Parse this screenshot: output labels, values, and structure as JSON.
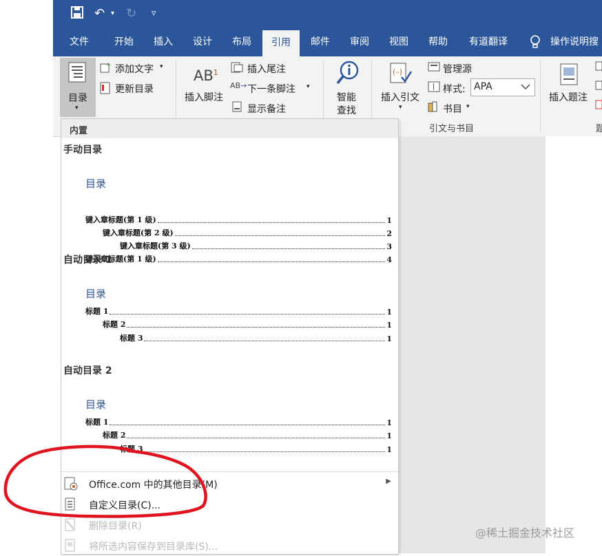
{
  "quick_access": {
    "save_icon": "save-icon",
    "undo_icon": "undo-icon",
    "redo_icon": "redo-icon",
    "customize_icon": "chevron-down-icon"
  },
  "tabs": [
    "文件",
    "开始",
    "插入",
    "设计",
    "布局",
    "引用",
    "邮件",
    "审阅",
    "视图",
    "帮助",
    "有道翻译"
  ],
  "active_tab": "引用",
  "tell_me": "操作说明搜",
  "ribbon": {
    "toc_button": "目录",
    "add_text": "添加文字",
    "update_toc": "更新目录",
    "insert_footnote": "插入脚注",
    "insert_endnote": "插入尾注",
    "next_footnote": "下一条脚注",
    "show_notes": "显示备注",
    "smart_lookup_1": "智能",
    "smart_lookup_2": "查找",
    "insert_citation": "插入引文",
    "manage_sources": "管理源",
    "style_label": "样式:",
    "style_value": "APA",
    "bibliography": "书目",
    "citations_group": "引文与书目",
    "insert_caption": "插入题注",
    "cut_off_label": "题"
  },
  "gallery": {
    "header": "内置",
    "manual": {
      "title": "手动目录",
      "toc_heading": "目录",
      "rows": [
        {
          "label": "键入章标题(第 1 级)",
          "page": "1"
        },
        {
          "label": "键入章标题(第 2 级)",
          "page": "2"
        },
        {
          "label": "键入章标题(第 3 级)",
          "page": "3"
        },
        {
          "label": "键入章标题(第 1 级)",
          "page": "4"
        }
      ]
    },
    "auto1": {
      "title": "自动目录 1",
      "toc_heading": "目录",
      "rows": [
        {
          "label": "标题 1",
          "page": "1"
        },
        {
          "label": "标题 2",
          "page": "1"
        },
        {
          "label": "标题 3",
          "page": "1"
        }
      ]
    },
    "auto2": {
      "title": "自动目录 2",
      "toc_heading": "目录",
      "rows": [
        {
          "label": "标题 1",
          "page": "1"
        },
        {
          "label": "标题 2",
          "page": "1"
        },
        {
          "label": "标题 3",
          "page": "1"
        }
      ]
    },
    "menu": {
      "office_more": "Office.com 中的其他目录(M)",
      "custom": "自定义目录(C)...",
      "remove": "删除目录(R)",
      "save_selection": "将所选内容保存到目录库(S)..."
    }
  },
  "watermark": "@稀土掘金技术社区",
  "colors": {
    "ribbon_blue": "#2b579a",
    "ribbon_bg": "#f3f3f3",
    "toc_heading_blue": "#2f5597",
    "annotation_red": "#e0141e"
  }
}
